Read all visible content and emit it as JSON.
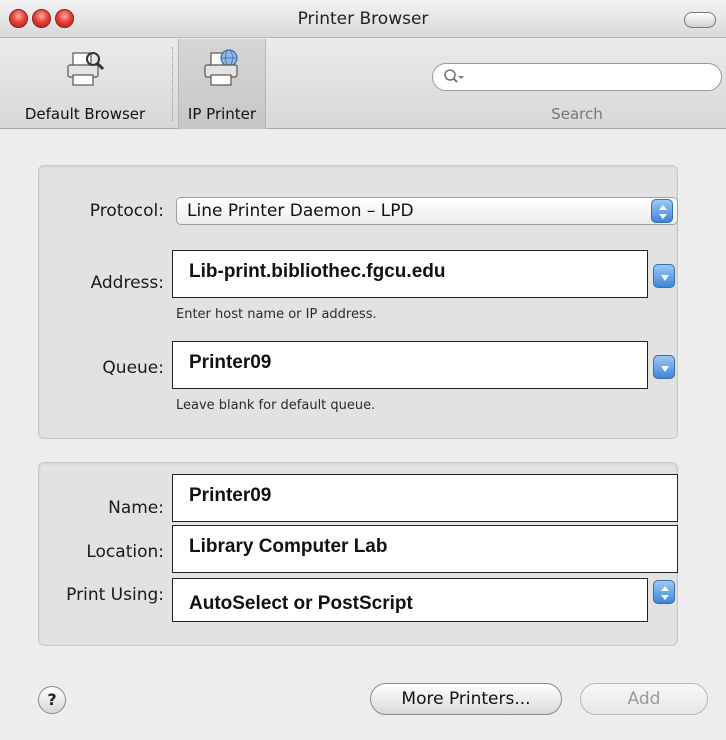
{
  "window": {
    "title": "Printer Browser"
  },
  "toolbar": {
    "default_browser_label": "Default Browser",
    "ip_printer_label": "IP Printer",
    "search_placeholder": "",
    "search_label": "Search"
  },
  "connection": {
    "protocol_label": "Protocol:",
    "protocol_value": "Line Printer Daemon – LPD",
    "address_label": "Address:",
    "address_value": "Lib-print.bibliothec.fgcu.edu",
    "address_hint": "Enter host name or IP address.",
    "queue_label": "Queue:",
    "queue_value": "Printer09",
    "queue_hint": "Leave blank for default queue."
  },
  "printer": {
    "name_label": "Name:",
    "name_value": "Printer09",
    "location_label": "Location:",
    "location_value": "Library Computer Lab",
    "print_using_label": "Print Using:",
    "print_using_value": "AutoSelect or PostScript"
  },
  "buttons": {
    "help_label": "?",
    "more_printers_label": "More Printers...",
    "add_label": "Add"
  },
  "colors": {
    "accent_blue": "#3d86d8",
    "close_red": "#e8413a",
    "disabled_text": "#9a9a9a"
  }
}
